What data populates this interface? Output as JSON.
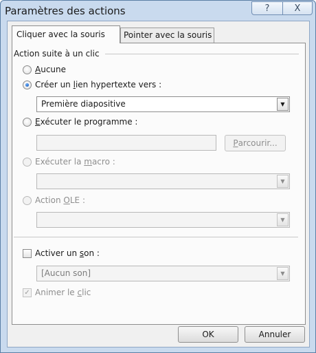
{
  "window": {
    "title": "Paramètres des actions",
    "help_label": "?",
    "close_label": "X"
  },
  "tabs": [
    {
      "label": "Cliquer avec la souris",
      "active": true
    },
    {
      "label": "Pointer avec la souris",
      "active": false
    }
  ],
  "group": {
    "label": "Action suite à un clic"
  },
  "options": {
    "aucune": {
      "prefix": "",
      "accel": "A",
      "suffix": "ucune",
      "checked": false,
      "enabled": true
    },
    "lien": {
      "prefix": "Créer un ",
      "accel": "l",
      "suffix": "ien hypertexte vers :",
      "checked": true,
      "enabled": true
    },
    "lien_value": "Première diapositive",
    "programme": {
      "prefix": "",
      "accel": "E",
      "suffix": "xécuter le programme :",
      "checked": false,
      "enabled": true
    },
    "programme_value": "",
    "parcourir": {
      "prefix": "",
      "accel": "P",
      "suffix": "arcourir..."
    },
    "macro": {
      "prefix": "Exécuter la ",
      "accel": "m",
      "suffix": "acro :",
      "checked": false,
      "enabled": false
    },
    "macro_value": "",
    "ole": {
      "prefix": "Action ",
      "accel": "O",
      "suffix": "LE :",
      "checked": false,
      "enabled": false
    },
    "ole_value": ""
  },
  "sound": {
    "prefix": "Activer un ",
    "accel": "s",
    "suffix": "on :",
    "checked": false,
    "value": "[Aucun son]"
  },
  "animate": {
    "prefix": "Animer le ",
    "accel": "c",
    "suffix": "lic",
    "checked": true,
    "enabled": false
  },
  "buttons": {
    "ok": "OK",
    "cancel": "Annuler"
  },
  "icons": {
    "dropdown": "triangle-down",
    "checkmark": "check"
  }
}
